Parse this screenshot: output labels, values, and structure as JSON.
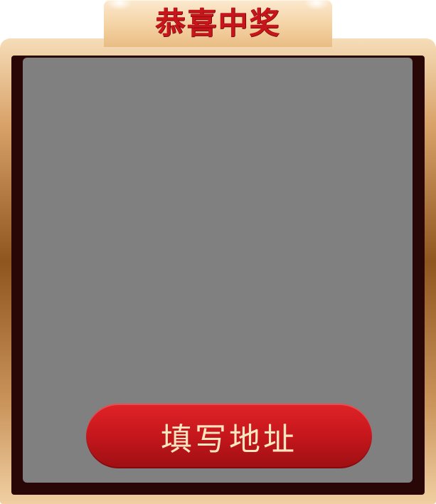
{
  "dialog": {
    "title": "恭喜中奖",
    "button_label": "填写地址"
  },
  "colors": {
    "title_red": "#c8151b",
    "button_red": "#c5171c",
    "button_text": "#fbe6c2",
    "frame_gold": "#d9a36a",
    "frame_dark": "#2a0707",
    "content_gray": "#808080"
  }
}
